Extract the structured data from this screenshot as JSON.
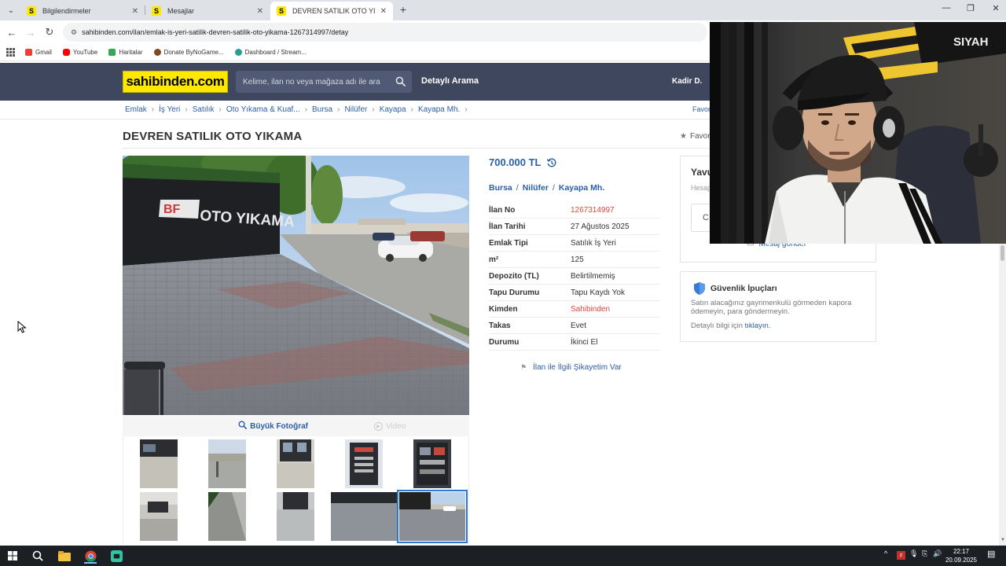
{
  "browser": {
    "tabs": [
      {
        "label": "Bilgilendirmeler",
        "favicon": "S"
      },
      {
        "label": "Mesajlar",
        "favicon": "S"
      },
      {
        "label": "DEVREN SATILIK OTO YIKAMA",
        "favicon": "S"
      }
    ],
    "url": "sahibinden.com/ilan/emlak-is-yeri-satilik-devren-satilik-oto-yikama-1267314997/detay",
    "bookmarks": [
      "Gmail",
      "YouTube",
      "Haritalar",
      "Donate ByNoGame...",
      "Dashboard / Stream..."
    ]
  },
  "site": {
    "logo": "sahibinden.com",
    "search_placeholder": "Kelime, ilan no veya mağaza adı ile ara",
    "detailed_search": "Detaylı Arama",
    "user": "Kadir D.",
    "favorites": "Favor",
    "favorites_top": "Favor",
    "brand_yellow": "#ffe800",
    "header_color": "#3f475f"
  },
  "breadcrumb": [
    "Emlak",
    "İş Yeri",
    "Satılık",
    "Oto Yıkama & Kuaf...",
    "Bursa",
    "Nilüfer",
    "Kayapa",
    "Kayapa Mh."
  ],
  "listing": {
    "title": "DEVREN SATILIK OTO YIKAMA",
    "price": "700.000 TL",
    "location": [
      "Bursa",
      "Nilüfer",
      "Kayapa Mh."
    ],
    "details": [
      {
        "label": "İlan No",
        "value": "1267314997",
        "red": true
      },
      {
        "label": "İlan Tarihi",
        "value": "27 Ağustos 2025",
        "red": false
      },
      {
        "label": "Emlak Tipi",
        "value": "Satılık İş Yeri",
        "red": false
      },
      {
        "label": "m²",
        "value": "125",
        "red": false
      },
      {
        "label": "Depozito (TL)",
        "value": "Belirtilmemiş",
        "red": false
      },
      {
        "label": "Tapu Durumu",
        "value": "Tapu Kaydı Yok",
        "red": false
      },
      {
        "label": "Kimden",
        "value": "Sahibinden",
        "red": true
      },
      {
        "label": "Takas",
        "value": "Evet",
        "red": false
      },
      {
        "label": "Durumu",
        "value": "İkinci El",
        "red": false
      }
    ],
    "report_link": "İlan ile İlgili Şikayetim Var",
    "big_photo": "Büyük Fotoğraf",
    "video": "Video",
    "photo_sign_text": "BF OTO YIKAMA"
  },
  "seller": {
    "name": "Yavu",
    "sub": "Hesap",
    "button": "C",
    "message": "Mesaj gönder"
  },
  "safety": {
    "title": "Güvenlik İpuçları",
    "text": "Satın alacağınız gayrimenkulü görmeden kapora ödemeyin, para göndermeyin.",
    "more_prefix": "Detaylı bilgi için ",
    "more_link": "tıklayın."
  },
  "taskbar": {
    "time": "22:17",
    "date": "20.09.2025"
  },
  "webcam": {
    "hoodie_text": "SIYAH"
  }
}
